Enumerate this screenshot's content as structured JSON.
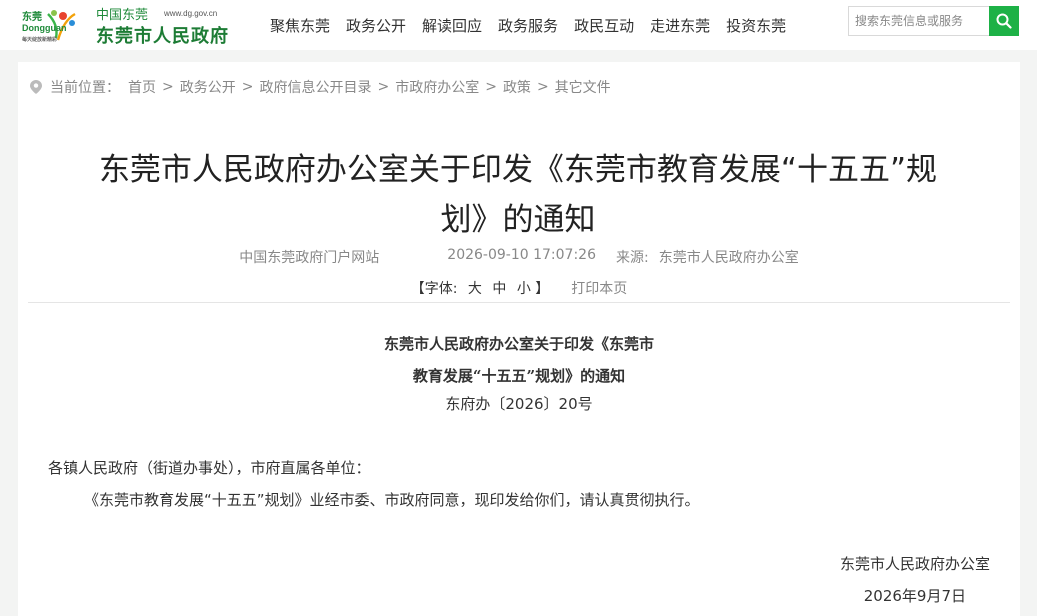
{
  "header": {
    "logo": {
      "city_cn": "东莞",
      "city_en": "Dongguan",
      "slogan": "每天绽放新精彩",
      "brand": "中国东莞",
      "domain": "www.dg.gov.cn",
      "gov_name": "东莞市人民政府"
    },
    "nav": [
      {
        "label": "聚焦东莞"
      },
      {
        "label": "政务公开"
      },
      {
        "label": "解读回应"
      },
      {
        "label": "政务服务"
      },
      {
        "label": "政民互动"
      },
      {
        "label": "走进东莞"
      },
      {
        "label": "投资东莞"
      }
    ],
    "search": {
      "placeholder": "搜索东莞信息或服务",
      "icon": "search-icon",
      "button_color": "#1db146"
    }
  },
  "breadcrumb": {
    "icon": "location-pin-icon",
    "label": "当前位置：",
    "items": [
      "首页",
      "政务公开",
      "政府信息公开目录",
      "市政府办公室",
      "政策",
      "其它文件"
    ],
    "separator": ">"
  },
  "article": {
    "title_line1": "东莞市人民政府办公室关于印发《东莞市教育发展“十五五”规",
    "title_line2": "划》的通知",
    "site": "中国东莞政府门户网站",
    "datetime": "2026-09-10 17:07:26",
    "source_label": "来源:",
    "source": "东莞市人民政府办公室",
    "font_open": "【字体:",
    "font_large": "大",
    "font_medium": "中",
    "font_small": "小",
    "font_close": "】",
    "print": "打印本页",
    "doc_title_line1": "东莞市人民政府办公室关于印发《东莞市",
    "doc_title_line2": "教育发展“十五五”规划》的通知",
    "doc_number": "东府办〔2026〕20号",
    "salutation": "各镇人民政府（街道办事处），市府直属各单位：",
    "body": "《东莞市教育发展“十五五”规划》业经市委、市政府同意，现印发给你们，请认真贯彻执行。",
    "signature_org": "东莞市人民政府办公室",
    "signature_date": "2026年9月7日"
  },
  "colors": {
    "brand_green": "#1d7c35",
    "accent_green": "#1db146",
    "page_bg": "#f3f4f3"
  }
}
